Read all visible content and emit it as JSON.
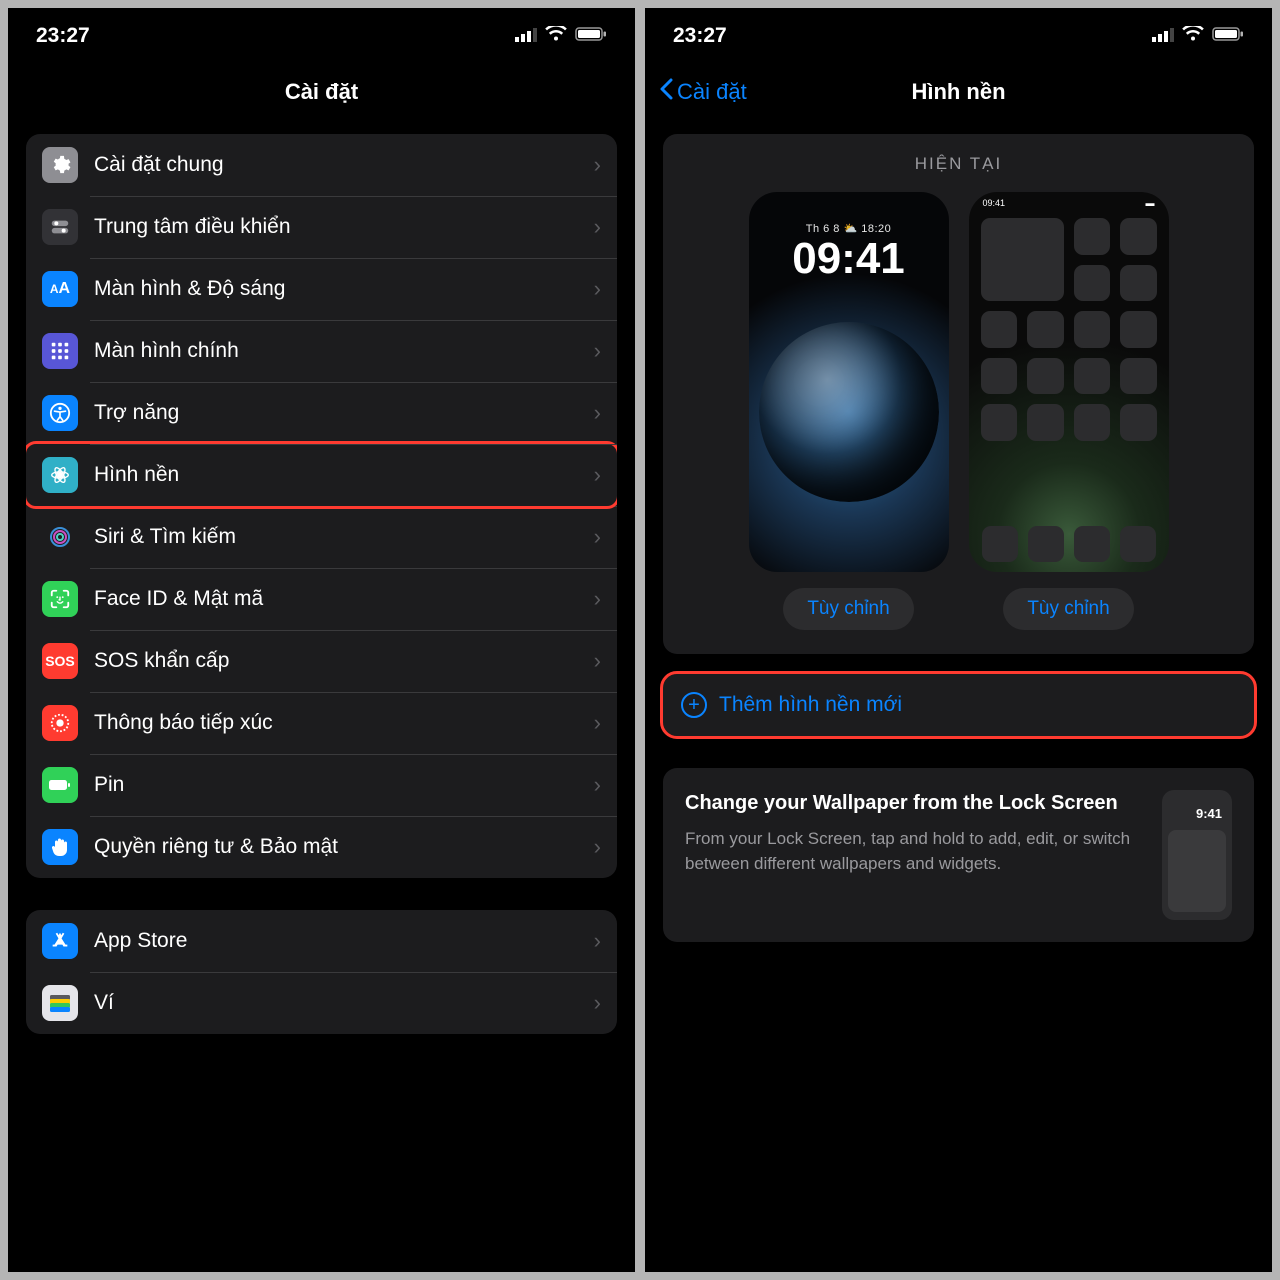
{
  "status": {
    "time": "23:27"
  },
  "left": {
    "title": "Cài đặt",
    "items": [
      {
        "label": "Cài đặt chung",
        "icon": "gear",
        "color": "ic-gray"
      },
      {
        "label": "Trung tâm điều khiển",
        "icon": "control",
        "color": "ic-ctrl"
      },
      {
        "label": "Màn hình & Độ sáng",
        "icon": "AA",
        "color": "ic-blue"
      },
      {
        "label": "Màn hình chính",
        "icon": "grid",
        "color": "ic-purple"
      },
      {
        "label": "Trợ năng",
        "icon": "access",
        "color": "ic-blue"
      },
      {
        "label": "Hình nền",
        "icon": "flower",
        "color": "ic-teal",
        "highlight": true
      },
      {
        "label": "Siri & Tìm kiếm",
        "icon": "siri",
        "color": "ic-dark"
      },
      {
        "label": "Face ID & Mật mã",
        "icon": "face",
        "color": "ic-green"
      },
      {
        "label": "SOS khẩn cấp",
        "icon": "SOS",
        "color": "ic-red"
      },
      {
        "label": "Thông báo tiếp xúc",
        "icon": "exposure",
        "color": "ic-red"
      },
      {
        "label": "Pin",
        "icon": "battery",
        "color": "ic-green"
      },
      {
        "label": "Quyền riêng tư & Bảo mật",
        "icon": "hand",
        "color": "ic-blue"
      }
    ],
    "items2": [
      {
        "label": "App Store",
        "icon": "appstore",
        "color": "ic-blue"
      },
      {
        "label": "Ví",
        "icon": "wallet",
        "color": "ic-wallet"
      }
    ]
  },
  "right": {
    "back": "Cài đặt",
    "title": "Hình nền",
    "current_label": "HIỆN TẠI",
    "lock_preview": {
      "date": "Th 6 8 ⛅ 18:20",
      "time": "09:41"
    },
    "home_preview_time": "09:41",
    "customize": "Tùy chỉnh",
    "add_new": "Thêm hình nền mới",
    "tip": {
      "title": "Change your Wallpaper from the Lock Screen",
      "sub": "From your Lock Screen, tap and hold to add, edit, or switch between different wallpapers and widgets.",
      "thumb_time": "9:41"
    }
  }
}
